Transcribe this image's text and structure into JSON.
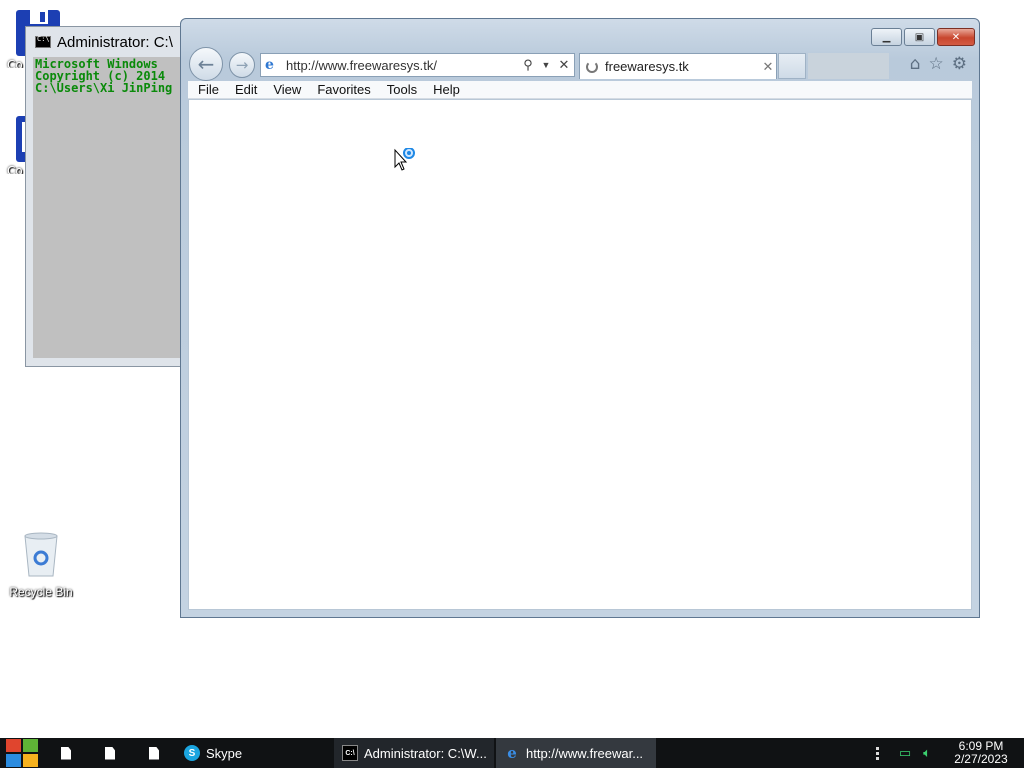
{
  "desktop": {
    "icons": [
      {
        "label": "Co"
      },
      {
        "label": "Co"
      },
      {
        "label": "Recycle Bin"
      }
    ]
  },
  "cmd_window": {
    "title": "Administrator: C:\\",
    "lines": [
      "Microsoft Windows",
      "Copyright (c) 2014",
      "",
      "C:\\Users\\Xi JinPing"
    ]
  },
  "ie_window": {
    "address_url": "http://www.freewaresys.tk/",
    "tab_title": "freewaresys.tk",
    "menu": [
      "File",
      "Edit",
      "View",
      "Favorites",
      "Tools",
      "Help"
    ],
    "icons": {
      "back": "back-arrow-icon",
      "forward": "forward-arrow-icon",
      "search": "search-icon",
      "home": "home-icon",
      "favorites": "star-icon",
      "settings": "gear-icon"
    }
  },
  "taskbar": {
    "tasks": [
      {
        "label": "Skype"
      },
      {
        "label": "Administrator: C:\\W..."
      },
      {
        "label": "http://www.freewar..."
      }
    ],
    "clock_time": "6:09 PM",
    "clock_date": "2/27/2023"
  },
  "colors": {
    "cmd_text": "#0a8a0a",
    "cmd_bg": "#c0c0c0",
    "taskbar": "#101214",
    "close_button": "#c8462e"
  }
}
